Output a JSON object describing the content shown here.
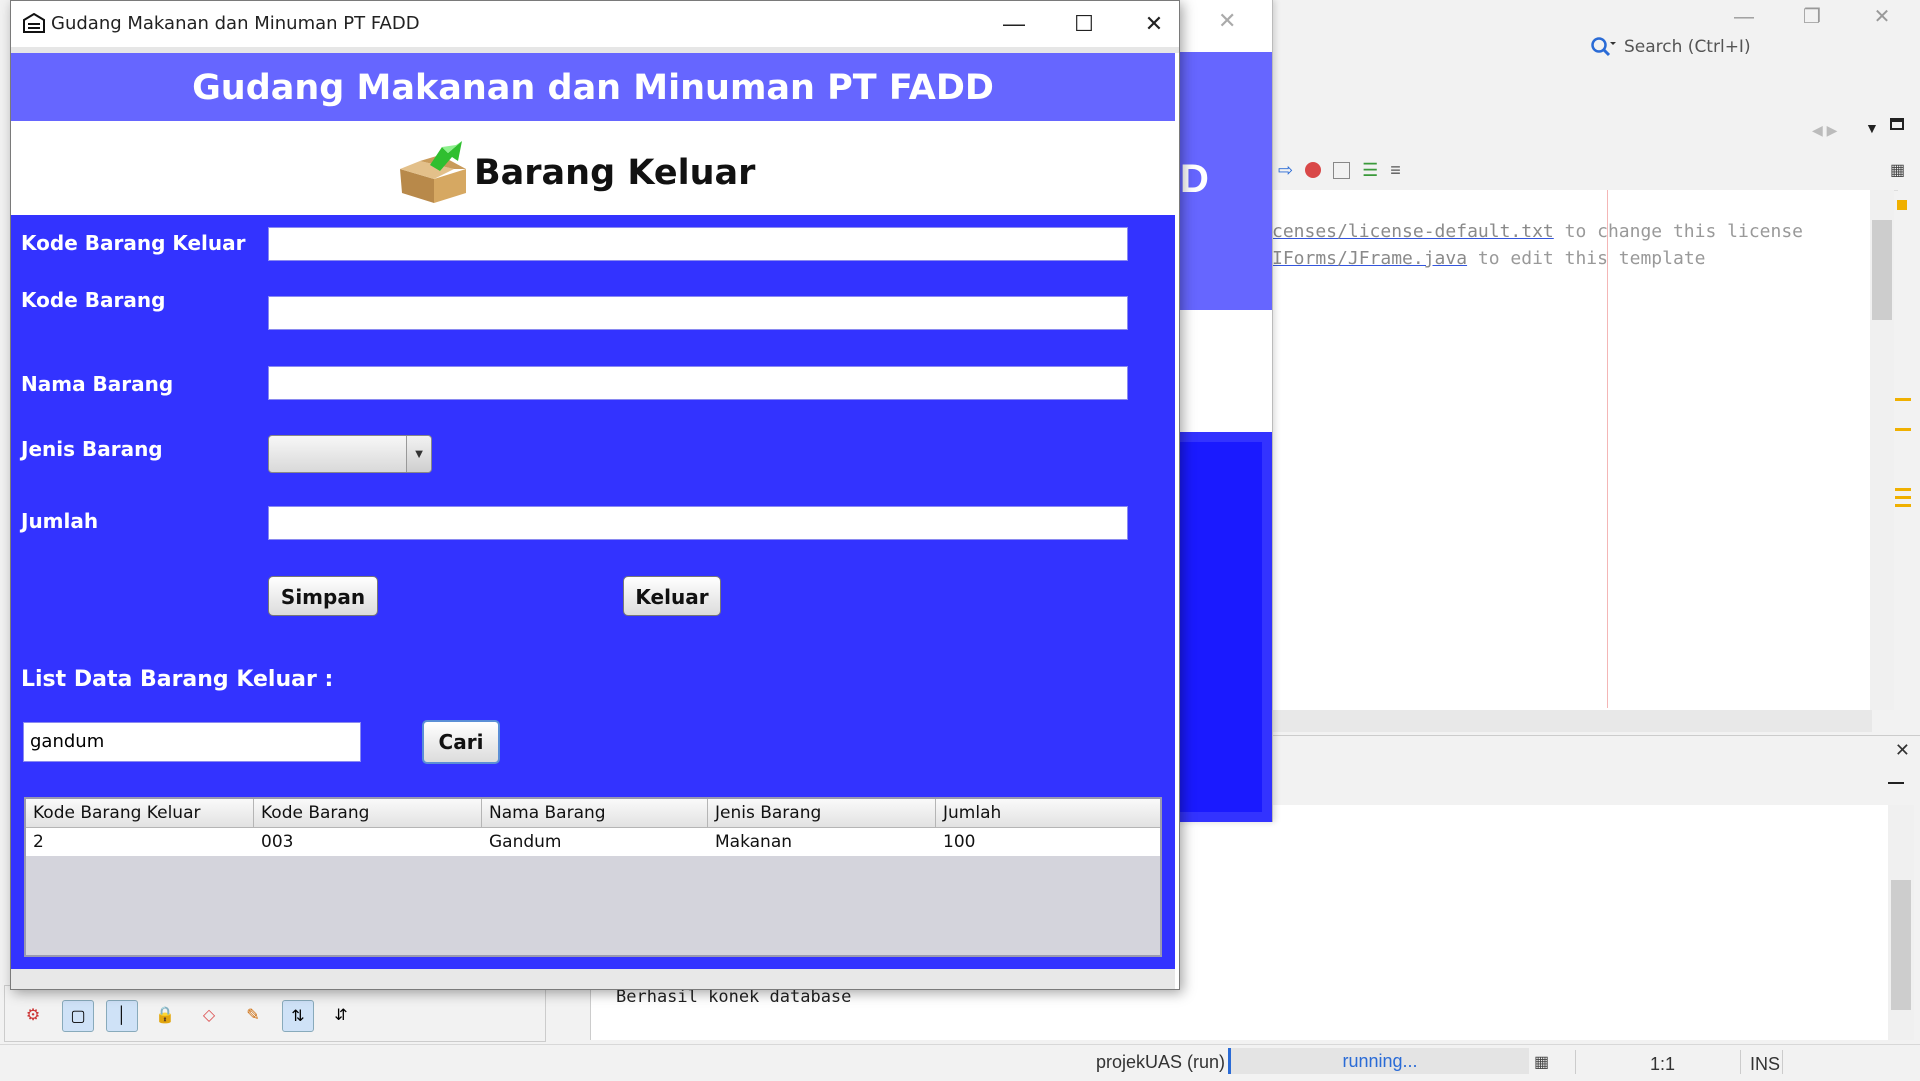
{
  "ide": {
    "search_label": "Search (Ctrl+I)",
    "editor_lines": [
      {
        "link": "censes/license-default.txt",
        "rest": " to change this license"
      },
      {
        "link": "IForms/JFrame.java",
        "rest": " to edit this template"
      }
    ],
    "output_text": "Berhasil konek database",
    "status": {
      "run_label": "projekUAS (run)",
      "progress_label": "running...",
      "position": "1:1",
      "mode": "INS"
    }
  },
  "window": {
    "title": "Gudang Makanan dan Minuman PT FADD",
    "header_title": "Gudang Makanan dan Minuman PT FADD",
    "sub_title": "Barang Keluar",
    "colors": {
      "header_band": "#6666ff",
      "form_band": "#3333ff"
    }
  },
  "form": {
    "labels": {
      "kode_barang_keluar": "Kode Barang Keluar",
      "kode_barang": "Kode Barang",
      "nama_barang": "Nama Barang",
      "jenis_barang": "Jenis Barang",
      "jumlah": "Jumlah"
    },
    "values": {
      "kode_barang_keluar": "",
      "kode_barang": "",
      "nama_barang": "",
      "jenis_barang": "",
      "jumlah": ""
    },
    "buttons": {
      "simpan": "Simpan",
      "keluar": "Keluar",
      "cari": "Cari"
    },
    "list_title": "List Data Barang Keluar :",
    "search_value": "gandum"
  },
  "table": {
    "columns": [
      "Kode Barang Keluar",
      "Kode Barang",
      "Nama Barang",
      "Jenis Barang",
      "Jumlah"
    ],
    "rows": [
      [
        "2",
        "003",
        "Gandum",
        "Makanan",
        "100"
      ]
    ]
  }
}
